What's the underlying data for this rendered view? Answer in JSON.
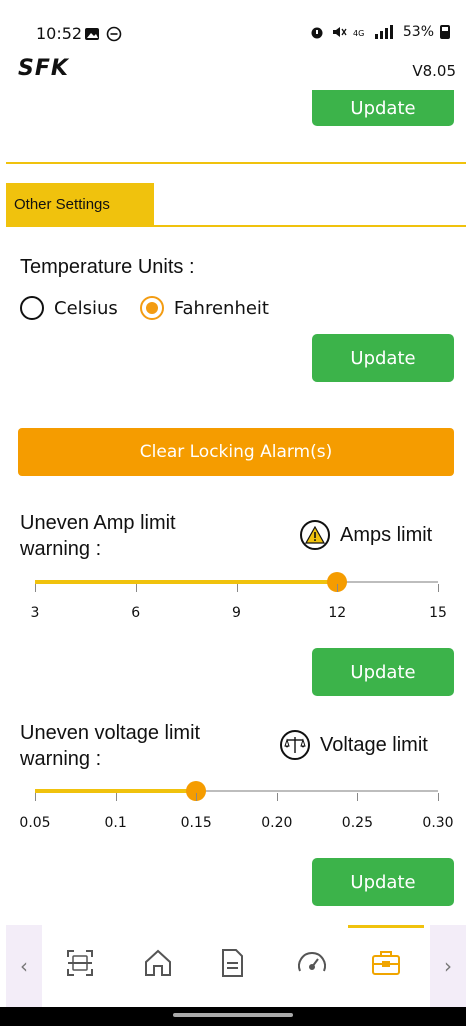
{
  "status_bar": {
    "time": "10:52",
    "right_text": "53%"
  },
  "header": {
    "logo": "SFK",
    "version": "V8.05"
  },
  "top_update_label": "Update",
  "other_settings": {
    "tab_label": "Other Settings",
    "temperature": {
      "label": "Temperature Units :",
      "options": [
        "Celsius",
        "Fahrenheit"
      ],
      "selected": "Fahrenheit",
      "update_label": "Update"
    },
    "clear_alarm_label": "Clear Locking Alarm(s)",
    "amp_limit": {
      "title_line1": "Uneven Amp limit",
      "title_line2": "warning :",
      "badge_label": "Amps limit",
      "ticks": [
        "3",
        "6",
        "9",
        "12",
        "15"
      ],
      "value": 12,
      "min": 3,
      "max": 15,
      "update_label": "Update"
    },
    "voltage_limit": {
      "title_line1": "Uneven voltage limit",
      "title_line2": "warning :",
      "badge_label": "Voltage limit",
      "ticks": [
        "0.05",
        "0.1",
        "0.15",
        "0.20",
        "0.25",
        "0.30"
      ],
      "value": 0.15,
      "min": 0.05,
      "max": 0.3,
      "update_label": "Update"
    }
  },
  "bottom_nav": {
    "items": [
      "scan-icon",
      "home-icon",
      "document-icon",
      "gauge-icon",
      "toolbox-icon"
    ],
    "active": "toolbox-icon"
  },
  "colors": {
    "accent_yellow": "#f0c20d",
    "accent_orange": "#f59c00",
    "update_green": "#3cb34a"
  }
}
